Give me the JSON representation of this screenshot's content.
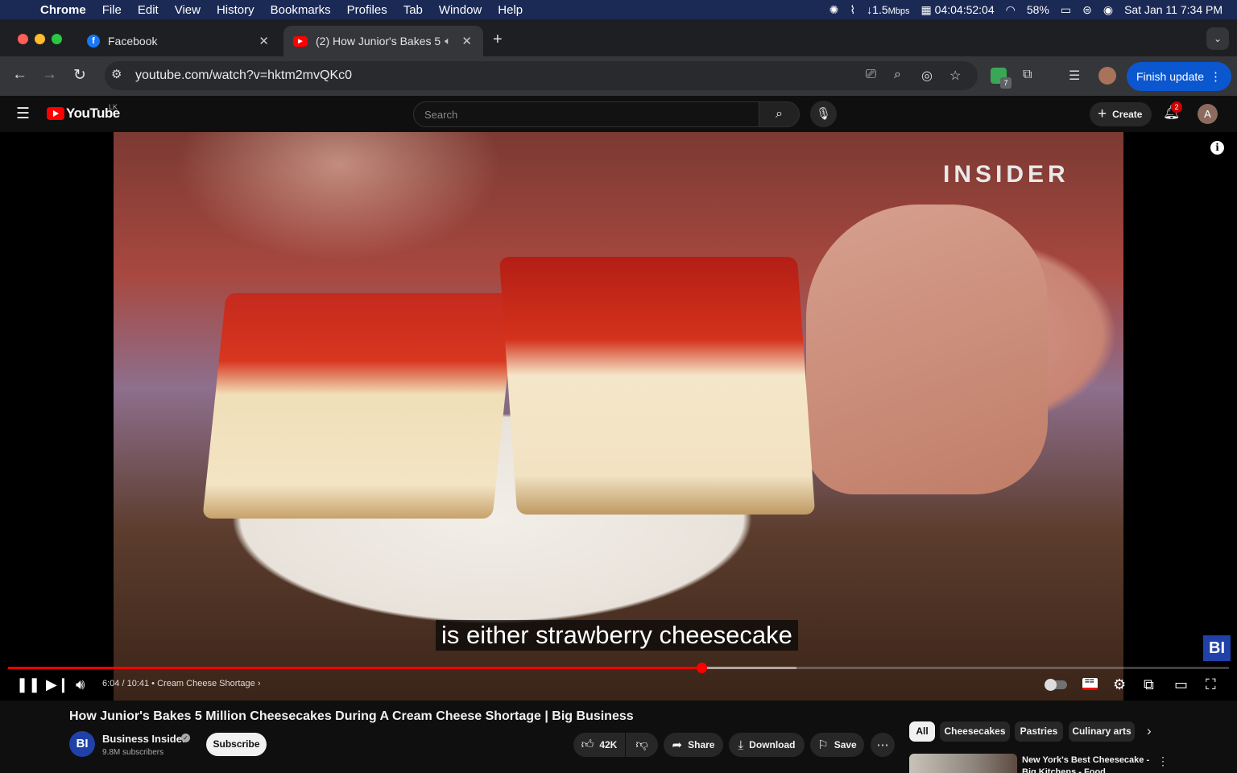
{
  "menubar": {
    "app": "Chrome",
    "items": [
      "File",
      "Edit",
      "View",
      "History",
      "Bookmarks",
      "Profiles",
      "Tab",
      "Window",
      "Help"
    ],
    "net_speed": "↓1.5",
    "net_unit": "Mbps",
    "uptime": "04:04:52:04",
    "battery": "58%",
    "datetime": "Sat Jan 11  7:34 PM"
  },
  "tabs": [
    {
      "title": "Facebook",
      "favicon": "facebook-icon"
    },
    {
      "title": "(2) How Junior's Bakes 5",
      "favicon": "youtube-icon"
    }
  ],
  "toolbar": {
    "url": "youtube.com/watch?v=hktm2mvQKc0",
    "extension_badge": "7",
    "finish_update_label": "Finish update"
  },
  "youtube": {
    "logo_text": "YouTube",
    "country": "LK",
    "search_placeholder": "Search",
    "create_label": "Create",
    "notification_count": "2",
    "avatar_initial": "A"
  },
  "player": {
    "watermark": "INSIDER",
    "caption": "is either strawberry cheesecake",
    "corner_logo": "BI",
    "current_time": "6:04",
    "duration": "10:41",
    "chapter": "Cream Cheese Shortage",
    "progress_fraction": 0.568,
    "buffered_fraction": 0.646
  },
  "video": {
    "title": "How Junior's Bakes 5 Million Cheesecakes During A Cream Cheese Shortage | Big Business",
    "channel_initials": "BI",
    "channel_name": "Business Insider",
    "subscribers": "9.8M subscribers",
    "subscribe_label": "Subscribe",
    "likes": "42K",
    "share_label": "Share",
    "download_label": "Download",
    "save_label": "Save"
  },
  "chips": [
    "All",
    "Cheesecakes",
    "Pastries",
    "Culinary arts"
  ],
  "recommendation": {
    "title": "New York's Best Cheesecake - Big Kitchens - Food"
  },
  "colors": {
    "accent_red": "#ff0000",
    "update_blue": "#0b57d0",
    "bi_blue": "#1f41a8"
  }
}
